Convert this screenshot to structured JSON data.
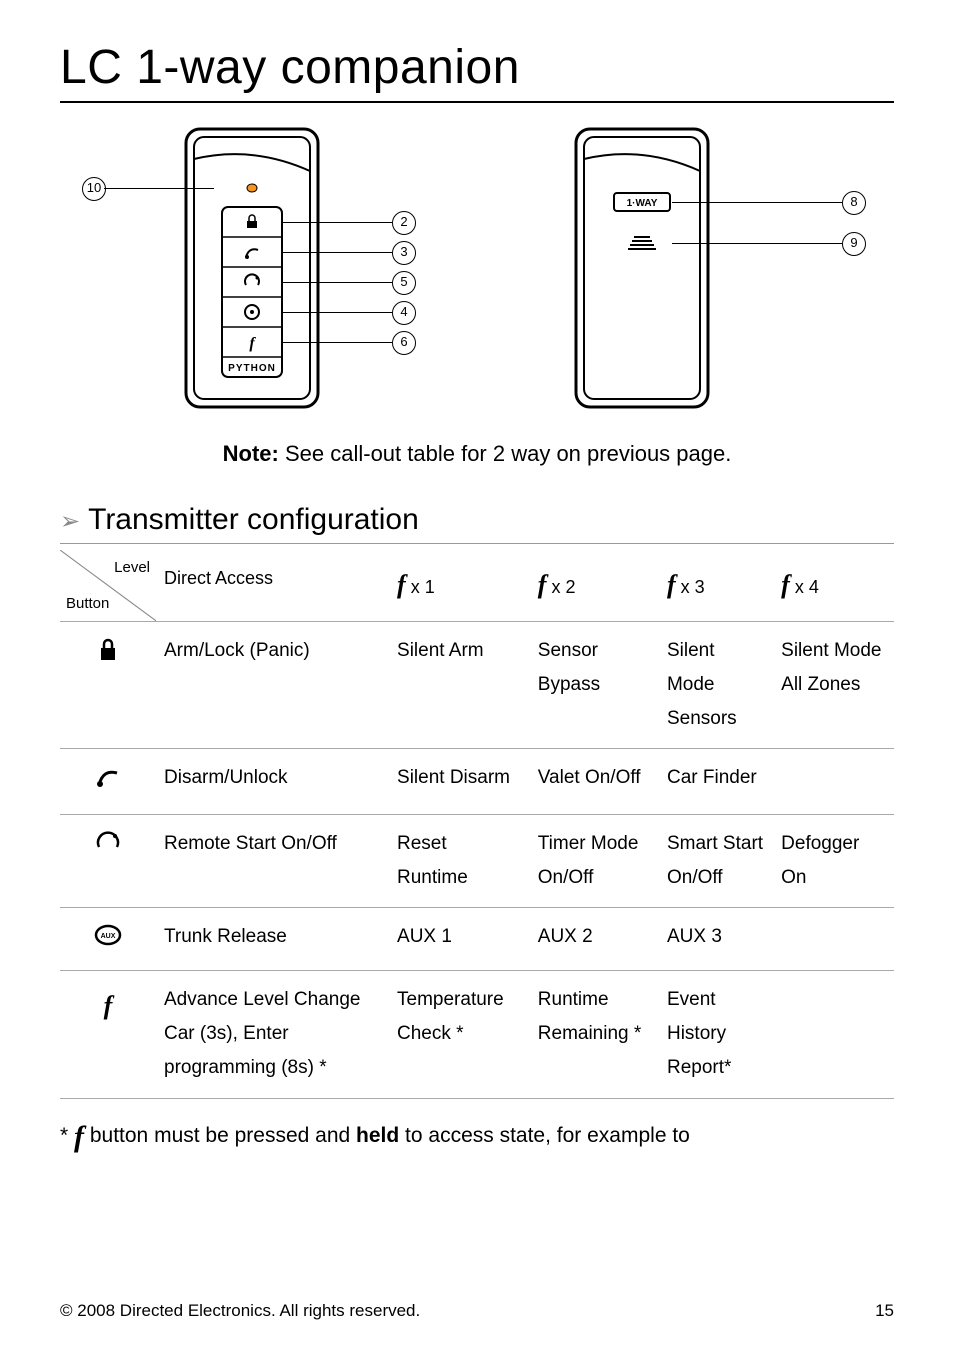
{
  "title": "LC 1-way companion",
  "callouts_front": [
    "10",
    "2",
    "3",
    "5",
    "4",
    "6"
  ],
  "callouts_back": [
    "8",
    "9"
  ],
  "remote_brand": "PYTHON",
  "back_label": "1-WAY",
  "note_bold": "Note:",
  "note_text": " See call-out table for 2 way on previous page.",
  "subhead": "Transmitter configuration",
  "corner": {
    "top": "Level",
    "bottom": "Button"
  },
  "headers": {
    "h1": "Direct Access",
    "h2x": " x 1",
    "h3x": " x 2",
    "h4x": " x 3",
    "h5x": " x 4"
  },
  "chart_data": {
    "type": "table",
    "rows": [
      {
        "icon": "lock",
        "direct": "Arm/Lock (Panic)",
        "f1": "Silent Arm",
        "f2": "Sensor Bypass",
        "f3": "Silent Mode Sensors",
        "f4": "Silent Mode All Zones"
      },
      {
        "icon": "key",
        "direct": "Disarm/Unlock",
        "f1": "Silent Disarm",
        "f2": "Valet On/Off",
        "f3": "Car Finder",
        "f4": ""
      },
      {
        "icon": "start",
        "direct": "Remote Start On/Off",
        "f1": "Reset Runtime",
        "f2": "Timer Mode On/Off",
        "f3": "Smart Start On/Off",
        "f4": "Defogger On"
      },
      {
        "icon": "aux",
        "direct": "Trunk Release",
        "f1": "AUX 1",
        "f2": "AUX 2",
        "f3": "AUX 3",
        "f4": ""
      },
      {
        "icon": "f",
        "direct": "Advance Level Change Car (3s), Enter programming (8s) *",
        "f1": "Temperature Check  *",
        "f2": "Runtime Remaining *",
        "f3": "Event History Report*",
        "f4": ""
      }
    ]
  },
  "footnote_pre": "* ",
  "footnote_mid": " button must be pressed and ",
  "footnote_bold": "held",
  "footnote_post": " to access state, for example to",
  "footer_left": "© 2008 Directed Electronics. All rights reserved.",
  "footer_right": "15"
}
